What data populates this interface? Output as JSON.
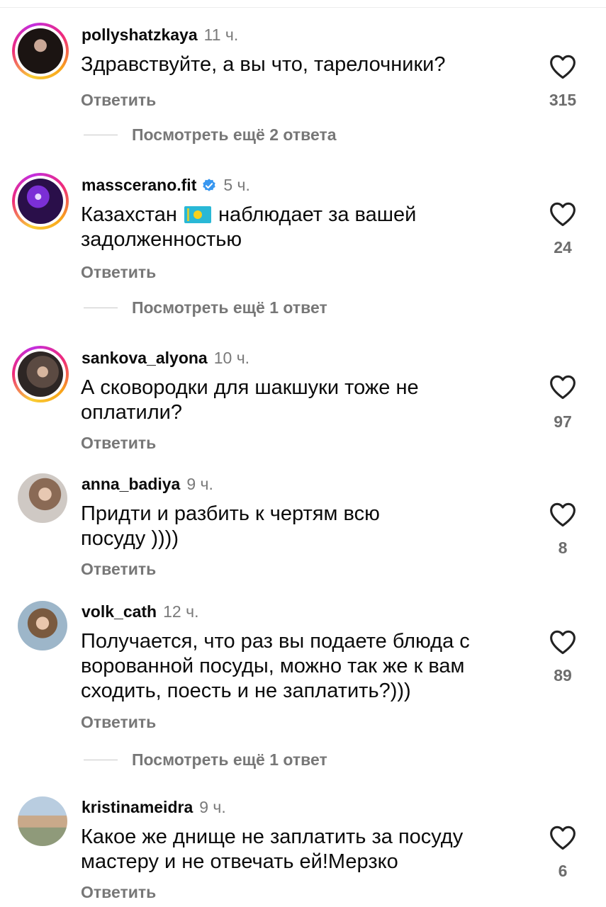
{
  "reply_label": "Ответить",
  "colors": {
    "ring_gradient": [
      "#f9ce34",
      "#ee2a7b",
      "#c22ee0"
    ],
    "secondary_text": "#777777",
    "verified": "#3897f0"
  },
  "comments": [
    {
      "username": "pollyshatzkaya",
      "time": "11 ч.",
      "text": "Здравствуйте, а вы что, тарелочники?",
      "likes": "315",
      "story_ring": true,
      "more_replies": "Посмотреть ещё 2 ответа"
    },
    {
      "username": "masscerano.fit",
      "verified": true,
      "time": "5 ч.",
      "text_before_flag": "Казахстан",
      "flag": "Kazakhstan flag",
      "text_after_flag": "наблюдает за вашей",
      "text_line2": "задолженностью",
      "likes": "24",
      "story_ring": true,
      "more_replies": "Посмотреть ещё 1 ответ"
    },
    {
      "username": "sankova_alyona",
      "time": "10 ч.",
      "text_line1": "А сковородки для шакшуки тоже не",
      "text_line2": "оплатили?",
      "likes": "97",
      "story_ring": true
    },
    {
      "username": "anna_badiya",
      "time": "9 ч.",
      "text_line1": "Придти и разбить к чертям всю",
      "text_line2": "посуду ))))",
      "likes": "8",
      "story_ring": false
    },
    {
      "username": "volk_cath",
      "time": "12 ч.",
      "text_line1": "Получается, что раз вы подаете блюда с",
      "text_line2": "ворованной посуды, можно так же к вам",
      "text_line3": "сходить, поесть и не заплатить?)))",
      "likes": "89",
      "story_ring": false,
      "more_replies": "Посмотреть ещё 1 ответ"
    },
    {
      "username": "kristinameidra",
      "time": "9 ч.",
      "text_line1": "Какое же днище не заплатить за посуду",
      "text_line2": "мастеру и не отвечать ей!Мерзко",
      "likes": "6",
      "story_ring": false
    }
  ]
}
